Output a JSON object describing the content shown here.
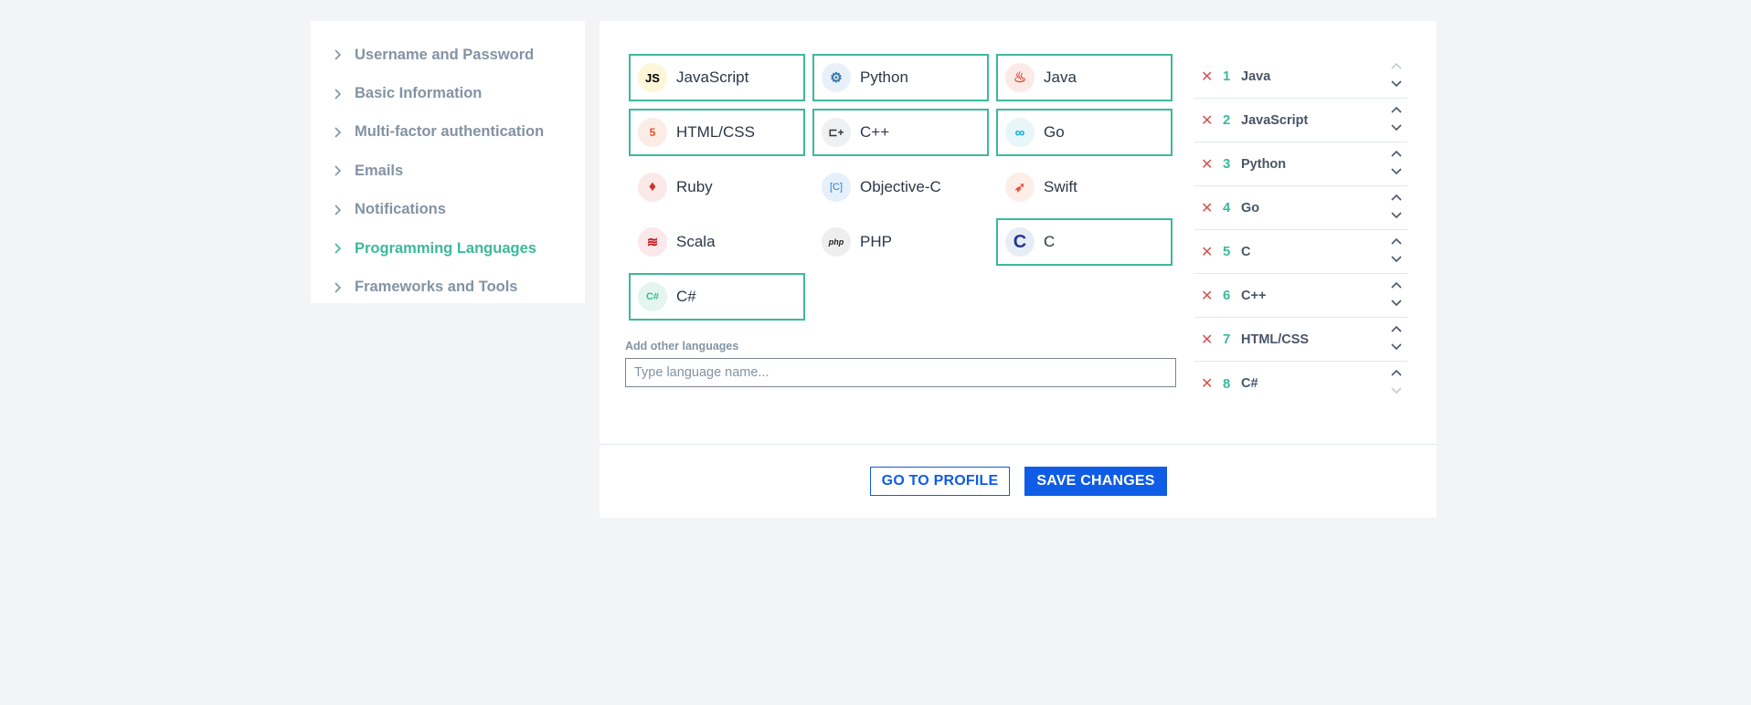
{
  "sidebar": {
    "items": [
      {
        "label": "Username and Password",
        "active": false
      },
      {
        "label": "Basic Information",
        "active": false
      },
      {
        "label": "Multi-factor authentication",
        "active": false
      },
      {
        "label": "Emails",
        "active": false
      },
      {
        "label": "Notifications",
        "active": false
      },
      {
        "label": "Programming Languages",
        "active": true
      },
      {
        "label": "Frameworks and Tools",
        "active": false
      }
    ]
  },
  "languages": [
    {
      "name": "JavaScript",
      "icon": "javascript-icon",
      "glyph": "JS",
      "selected": true
    },
    {
      "name": "Python",
      "icon": "python-icon",
      "glyph": "⚙",
      "selected": true
    },
    {
      "name": "Java",
      "icon": "java-icon",
      "glyph": "♨",
      "selected": true
    },
    {
      "name": "HTML/CSS",
      "icon": "html5-icon",
      "glyph": "5",
      "selected": true
    },
    {
      "name": "C++",
      "icon": "cpp-icon",
      "glyph": "⊏+",
      "selected": true
    },
    {
      "name": "Go",
      "icon": "go-icon",
      "glyph": "∞",
      "selected": true
    },
    {
      "name": "Ruby",
      "icon": "ruby-icon",
      "glyph": "♦",
      "selected": false
    },
    {
      "name": "Objective-C",
      "icon": "objective-c-icon",
      "glyph": "[C]",
      "selected": false
    },
    {
      "name": "Swift",
      "icon": "swift-icon",
      "glyph": "➶",
      "selected": false
    },
    {
      "name": "Scala",
      "icon": "scala-icon",
      "glyph": "≋",
      "selected": false
    },
    {
      "name": "PHP",
      "icon": "php-icon",
      "glyph": "php",
      "selected": false
    },
    {
      "name": "C",
      "icon": "c-icon",
      "glyph": "C",
      "selected": true
    },
    {
      "name": "C#",
      "icon": "csharp-icon",
      "glyph": "C#",
      "selected": true
    }
  ],
  "add_other": {
    "label": "Add other languages",
    "placeholder": "Type language name..."
  },
  "ranking": [
    {
      "rank": "1",
      "name": "Java"
    },
    {
      "rank": "2",
      "name": "JavaScript"
    },
    {
      "rank": "3",
      "name": "Python"
    },
    {
      "rank": "4",
      "name": "Go"
    },
    {
      "rank": "5",
      "name": "C"
    },
    {
      "rank": "6",
      "name": "C++"
    },
    {
      "rank": "7",
      "name": "HTML/CSS"
    },
    {
      "rank": "8",
      "name": "C#"
    }
  ],
  "buttons": {
    "go_to_profile": "GO TO PROFILE",
    "save_changes": "SAVE CHANGES"
  },
  "colors": {
    "accent": "#3cb99b",
    "primary": "#0f5ce6",
    "remove": "#d9534f",
    "muted": "#8393a3"
  }
}
